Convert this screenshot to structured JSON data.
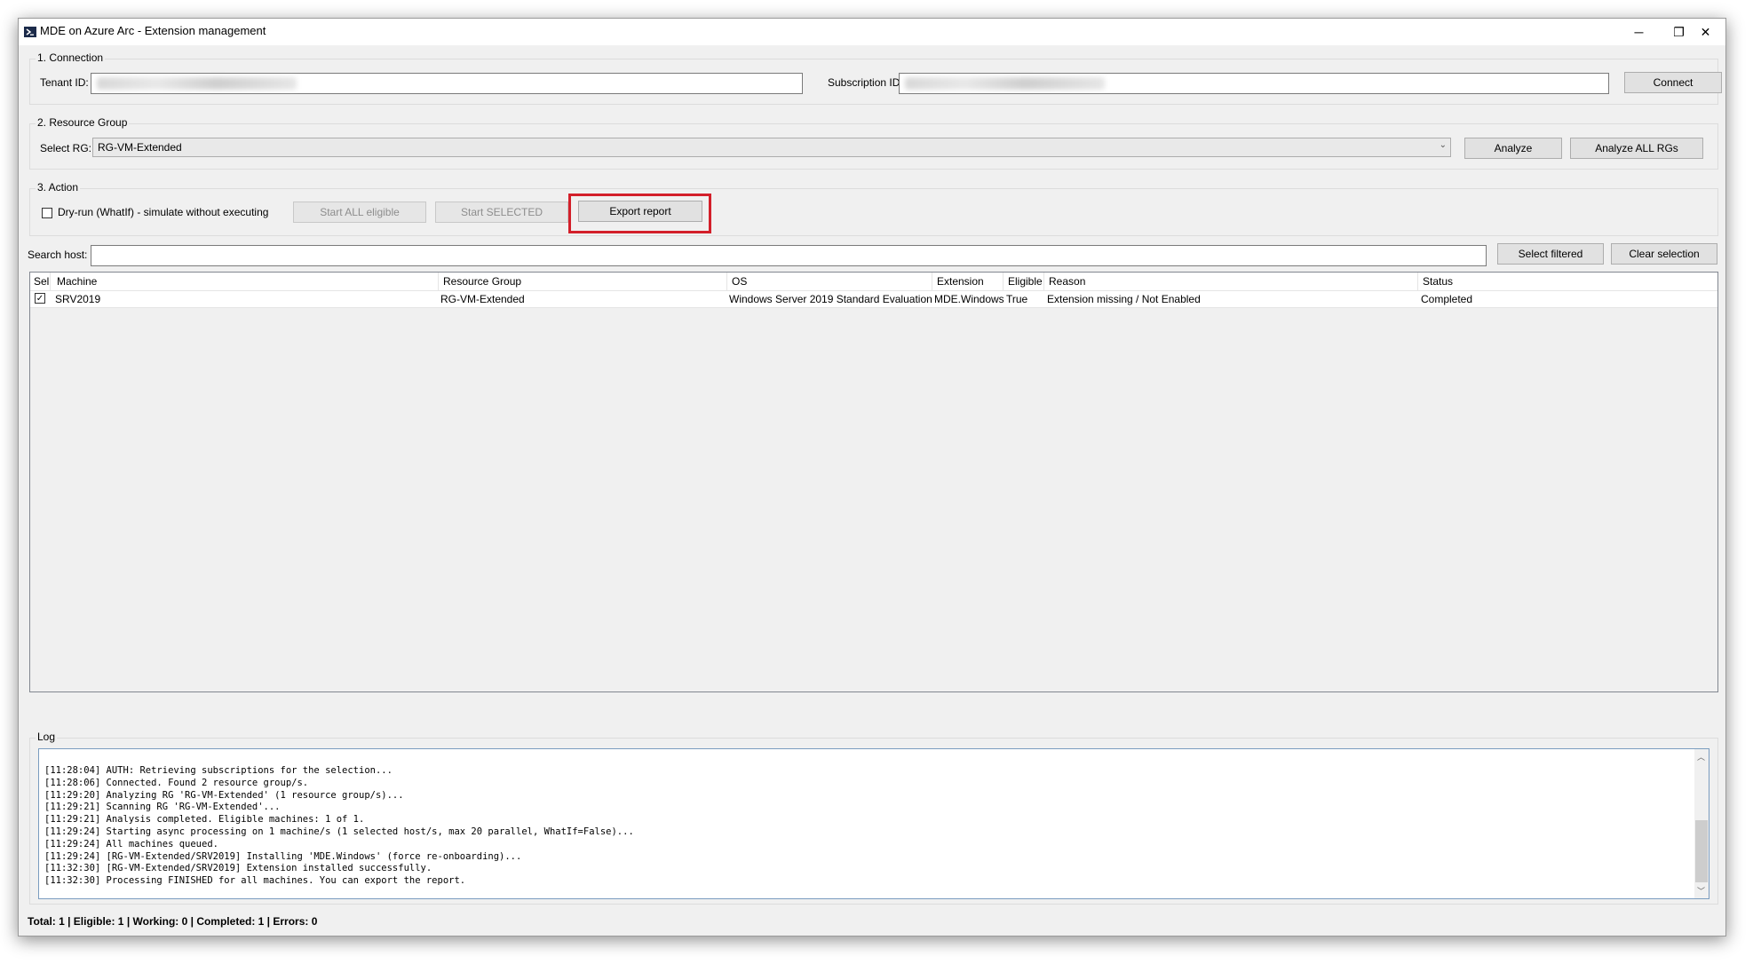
{
  "window": {
    "title": "MDE on Azure Arc - Extension management",
    "minimize_glyph": "─",
    "restore_glyph": "❐",
    "close_glyph": "✕"
  },
  "connection": {
    "legend": "1. Connection",
    "tenant_label": "Tenant ID:",
    "subscription_label": "Subscription ID:",
    "connect_button": "Connect"
  },
  "resource_group": {
    "legend": "2. Resource Group",
    "select_label": "Select RG:",
    "selected_value": "RG-VM-Extended",
    "analyze_button": "Analyze",
    "analyze_all_button": "Analyze ALL RGs"
  },
  "action": {
    "legend": "3. Action",
    "dry_run_label": "Dry-run (WhatIf) - simulate without executing",
    "dry_run_checked": false,
    "start_all_button": "Start ALL eligible",
    "start_selected_button": "Start SELECTED",
    "export_button": "Export report"
  },
  "search": {
    "label": "Search host:",
    "value": "",
    "select_filtered_button": "Select filtered",
    "clear_selection_button": "Clear selection"
  },
  "grid": {
    "columns": [
      "Sel",
      "Machine",
      "Resource Group",
      "OS",
      "Extension",
      "Eligible",
      "Reason",
      "Status"
    ],
    "rows": [
      {
        "sel": true,
        "machine": "SRV2019",
        "resource_group": "RG-VM-Extended",
        "os": "Windows Server 2019 Standard Evaluation",
        "extension": "MDE.Windows",
        "eligible": "True",
        "reason": "Extension missing / Not Enabled",
        "status": "Completed"
      }
    ]
  },
  "log": {
    "legend": "Log",
    "text": "[11:28:04] AUTH: Retrieving subscriptions for the selection...\n[11:28:06] Connected. Found 2 resource group/s.\n[11:29:20] Analyzing RG 'RG-VM-Extended' (1 resource group/s)...\n[11:29:21] Scanning RG 'RG-VM-Extended'...\n[11:29:21] Analysis completed. Eligible machines: 1 of 1.\n[11:29:24] Starting async processing on 1 machine/s (1 selected host/s, max 20 parallel, WhatIf=False)...\n[11:29:24] All machines queued.\n[11:29:24] [RG-VM-Extended/SRV2019] Installing 'MDE.Windows' (force re-onboarding)...\n[11:32:30] [RG-VM-Extended/SRV2019] Extension installed successfully.\n[11:32:30] Processing FINISHED for all machines. You can export the report."
  },
  "status_bar": {
    "text": "Total: 1  |  Eligible: 1  |  Working: 0  |  Completed: 1  |  Errors: 0"
  },
  "colors": {
    "highlight": "#d31f2a",
    "window_bg": "#f0f0f0"
  }
}
